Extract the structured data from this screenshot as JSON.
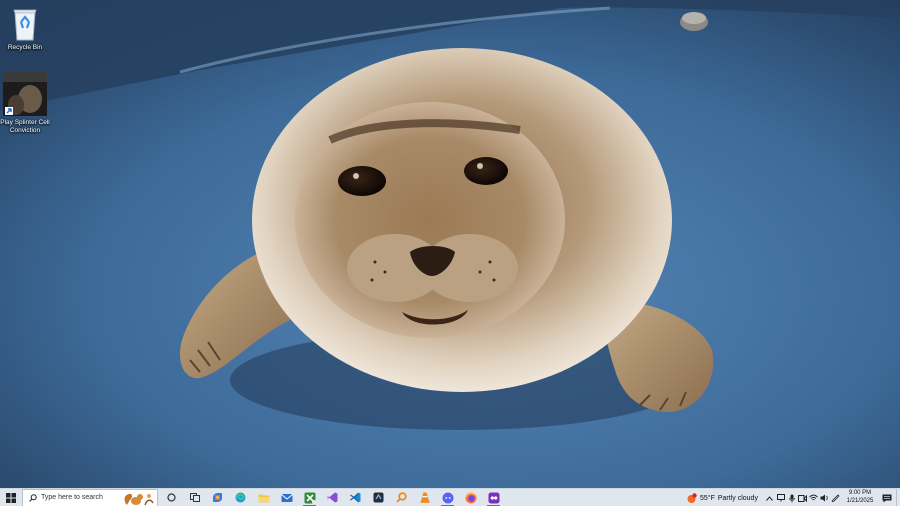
{
  "desktop": {
    "icons": [
      {
        "label": "Recycle Bin",
        "icon": "recycle-bin-icon"
      },
      {
        "label": "Play Splinter Cell Conviction",
        "icon": "game-shortcut-icon"
      }
    ],
    "wallpaper": "seal-pup-on-blue-floor"
  },
  "taskbar": {
    "search_placeholder": "Type here to search",
    "apps": [
      {
        "name": "task-view",
        "icon": "task-view-icon",
        "active": false
      },
      {
        "name": "widgets",
        "icon": "widgets-icon",
        "active": false
      },
      {
        "name": "copilot",
        "icon": "copilot-icon",
        "active": false
      },
      {
        "name": "edge",
        "icon": "edge-icon",
        "active": false
      },
      {
        "name": "file-explorer",
        "icon": "folder-icon",
        "active": false
      },
      {
        "name": "mail",
        "icon": "mail-icon",
        "active": false
      },
      {
        "name": "xbox",
        "icon": "xbox-icon",
        "active": true
      },
      {
        "name": "visual-studio",
        "icon": "visual-studio-icon",
        "active": false
      },
      {
        "name": "vscode",
        "icon": "vscode-icon",
        "active": false
      },
      {
        "name": "app-dark",
        "icon": "dark-app-icon",
        "active": false
      },
      {
        "name": "search-app",
        "icon": "orange-search-icon",
        "active": false
      },
      {
        "name": "vlc",
        "icon": "vlc-icon",
        "active": false
      },
      {
        "name": "discord",
        "icon": "discord-icon",
        "active": true
      },
      {
        "name": "firefox",
        "icon": "firefox-icon",
        "active": false
      },
      {
        "name": "app-purple",
        "icon": "purple-app-icon",
        "active": true
      }
    ],
    "weather": {
      "temp": "55°F",
      "condition": "Partly cloudy"
    },
    "clock": {
      "time": "9:00 PM",
      "date": "1/21/2025"
    }
  },
  "colors": {
    "taskbar_bg": "#dfe6ee",
    "accent": "#3b7dd8",
    "floor_blue": "#3f6d9c"
  }
}
